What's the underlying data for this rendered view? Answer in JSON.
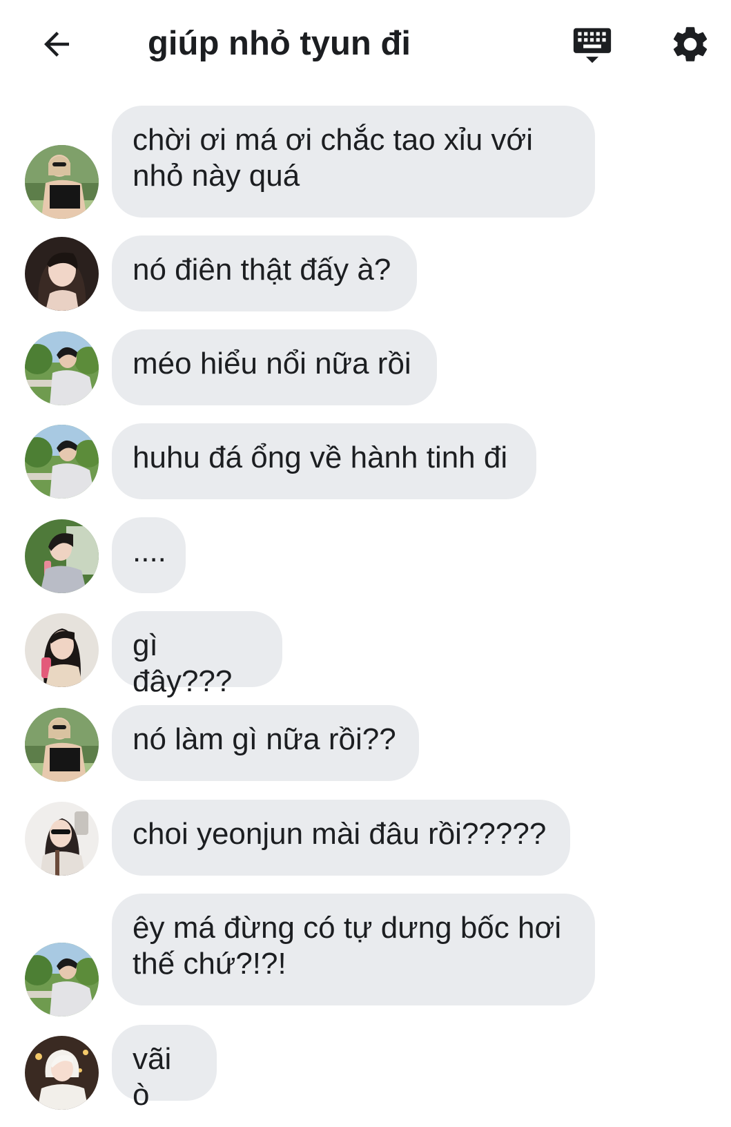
{
  "header": {
    "title": "giúp nhỏ tyun đi",
    "back_icon": "arrow-left-icon",
    "keyboard_icon": "keyboard-icon",
    "settings_icon": "gear-icon"
  },
  "messages": [
    {
      "text": "chời ơi má ơi chắc tao xỉu với nhỏ này quá",
      "avatar": "user-a"
    },
    {
      "text": "nó điên thật đấy à?",
      "avatar": "user-b"
    },
    {
      "text": "méo hiểu nổi nữa rồi",
      "avatar": "user-c"
    },
    {
      "text": "huhu đá ổng về hành tinh đi",
      "avatar": "user-c"
    },
    {
      "text": "....",
      "avatar": "user-d"
    },
    {
      "text": "gì đây???",
      "avatar": "user-e"
    },
    {
      "text": "nó làm gì nữa rồi??",
      "avatar": "user-a"
    },
    {
      "text": "choi yeonjun mài đâu rồi?????",
      "avatar": "user-f"
    },
    {
      "text": "êy má đừng có tự dưng bốc hơi thế chứ?!?!",
      "avatar": "user-c"
    },
    {
      "text": "vãi ò",
      "avatar": "user-g"
    }
  ],
  "colors": {
    "bubble": "#e9ebee",
    "text": "#1c1e21",
    "background": "#ffffff"
  }
}
